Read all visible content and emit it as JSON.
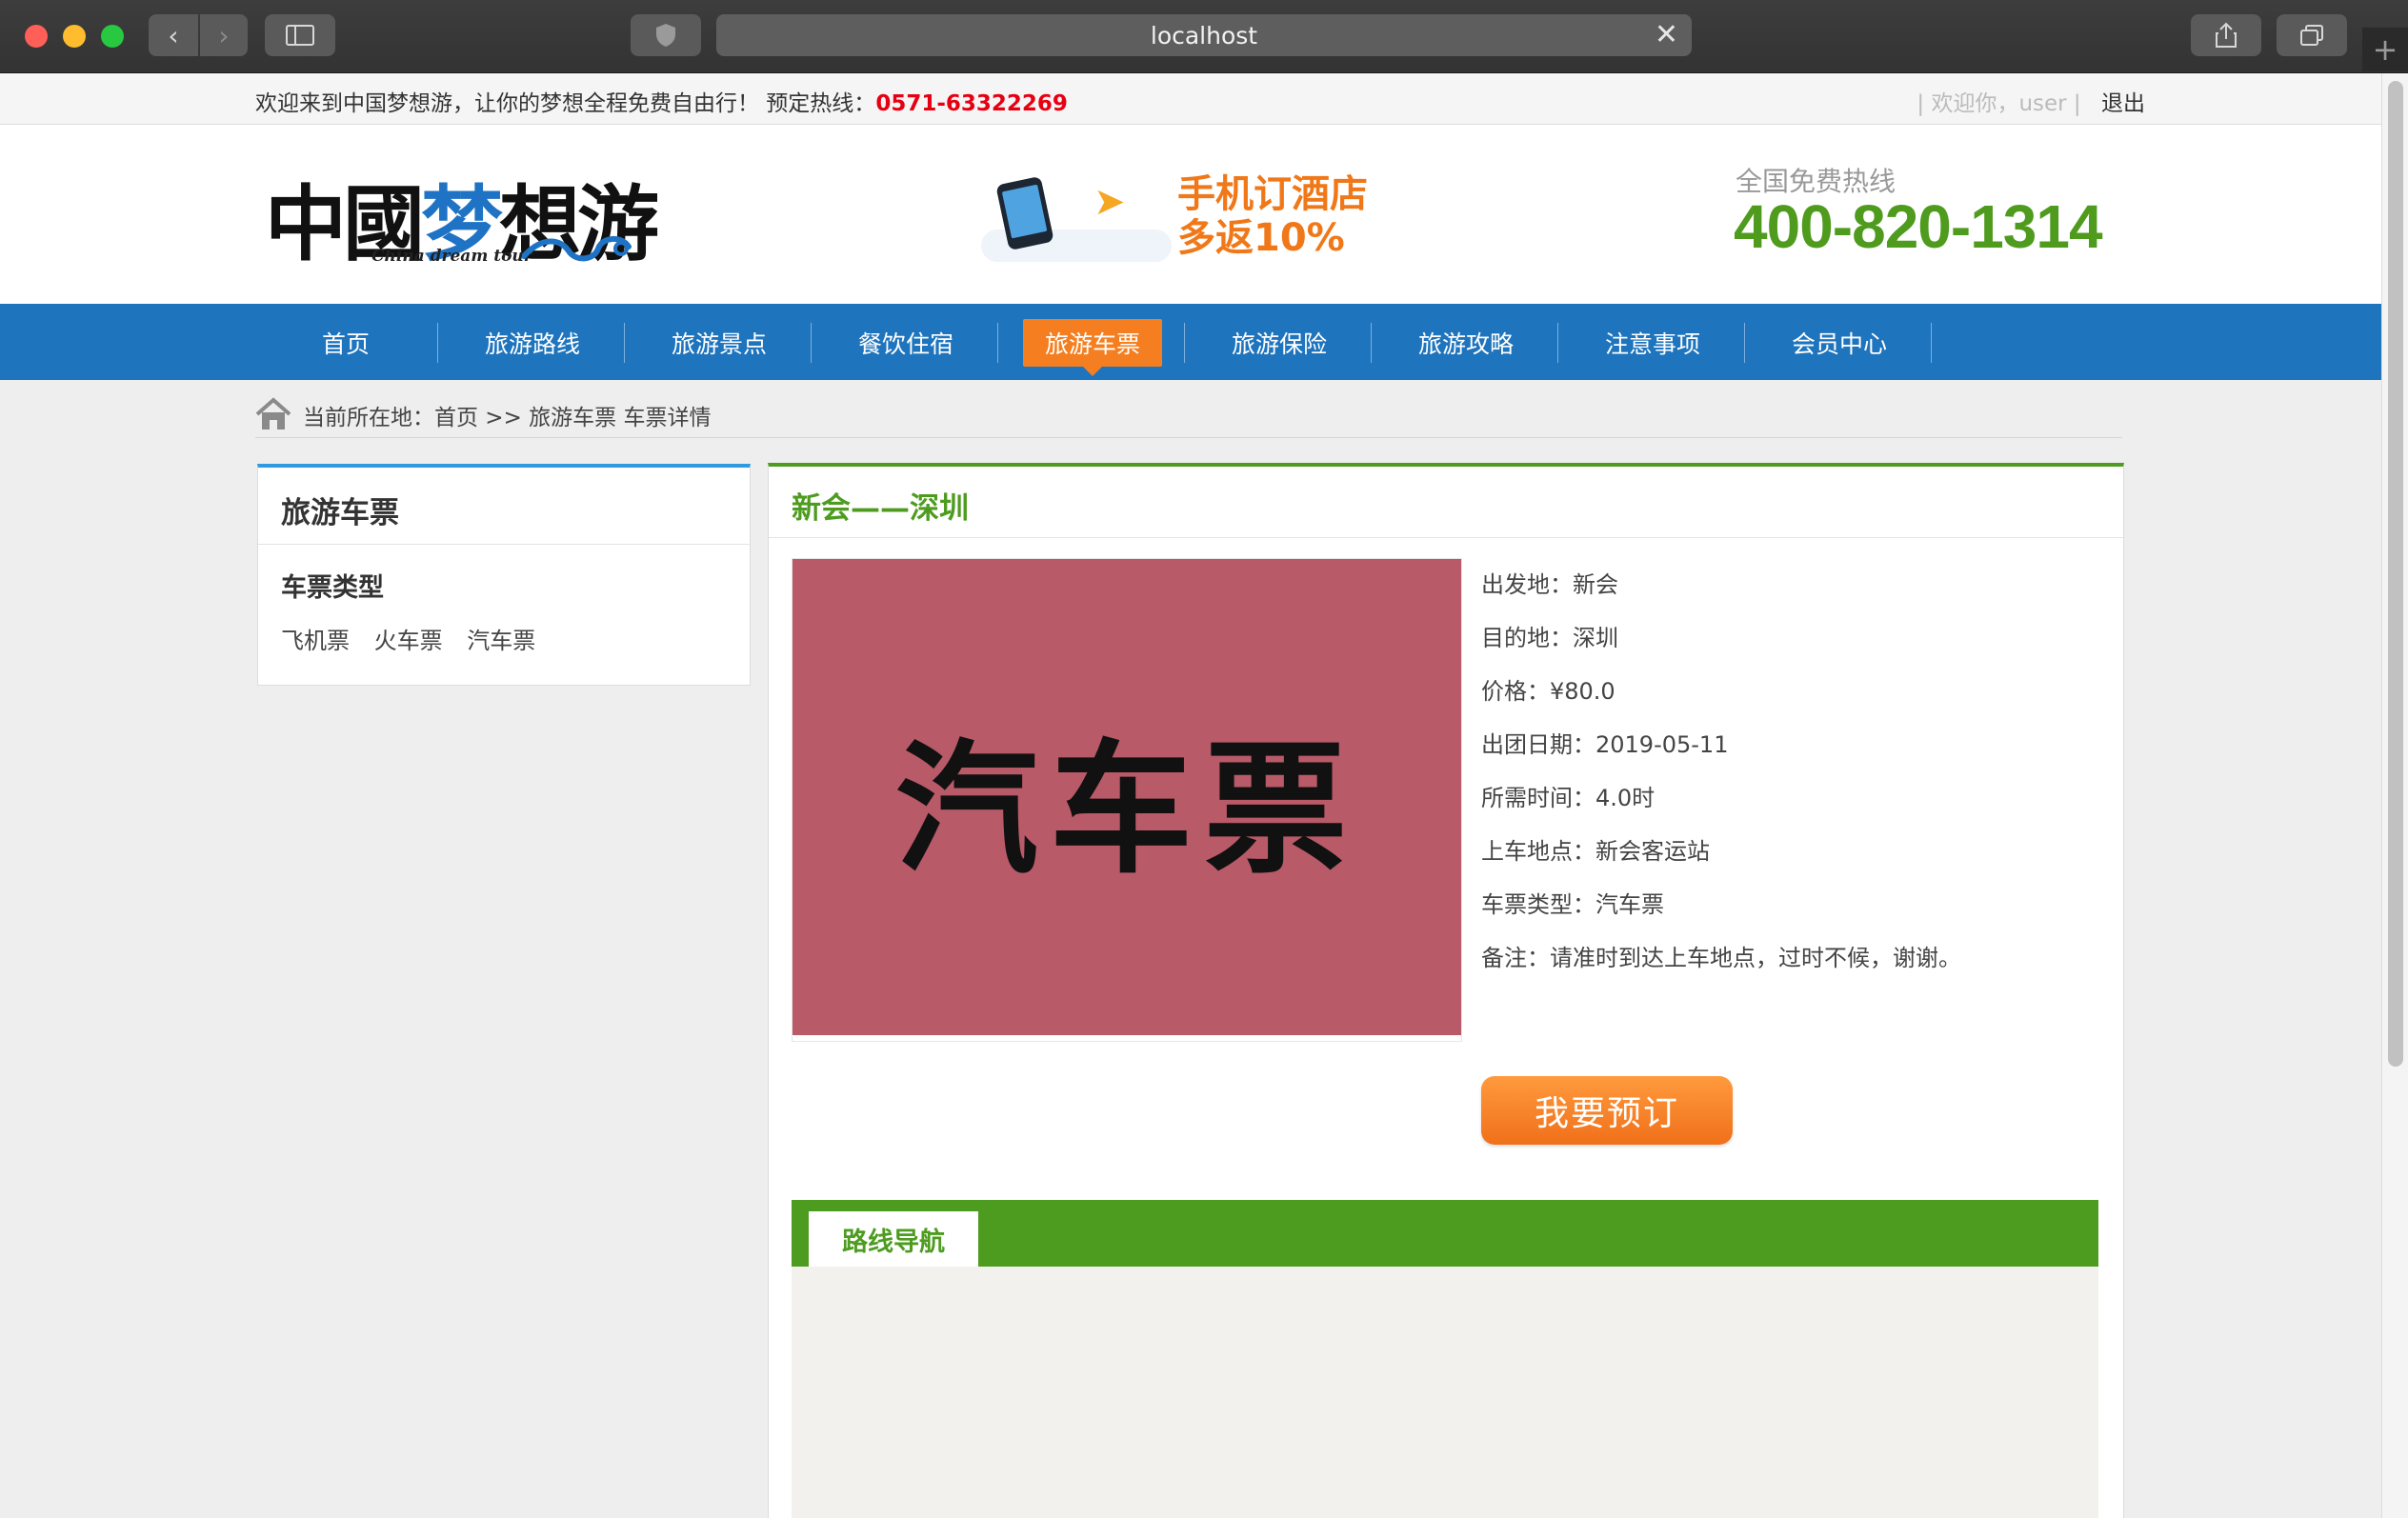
{
  "browser": {
    "url": "localhost"
  },
  "topbar": {
    "welcome": "欢迎来到中国梦想游，让你的梦想全程免费自由行！ 预定热线：",
    "hotline": "0571-63322269",
    "greeting": "| 欢迎你，user |",
    "logout": "退出"
  },
  "header": {
    "logo_text_a": "中國",
    "logo_text_b": "梦",
    "logo_text_c": "想游",
    "logo_sub": "China dream tour",
    "promo_line1": "手机订酒店",
    "promo_line2": "多返10%",
    "hotline_label": "全国免费热线",
    "hotline_number": "400-820-1314"
  },
  "nav": {
    "items": [
      {
        "label": "首页"
      },
      {
        "label": "旅游路线"
      },
      {
        "label": "旅游景点"
      },
      {
        "label": "餐饮住宿"
      },
      {
        "label": "旅游车票"
      },
      {
        "label": "旅游保险"
      },
      {
        "label": "旅游攻略"
      },
      {
        "label": "注意事项"
      },
      {
        "label": "会员中心"
      }
    ],
    "active_index": 4
  },
  "breadcrumb": {
    "text": "当前所在地：首页 >> 旅游车票 车票详情"
  },
  "sidebar": {
    "title": "旅游车票",
    "subtitle": "车票类型",
    "links": [
      "飞机票",
      "火车票",
      "汽车票"
    ]
  },
  "detail": {
    "title": "新会——深圳",
    "image_text": "汽车票",
    "image_color": "#b95a68",
    "info": [
      "出发地：新会",
      "目的地：深圳",
      "价格：¥80.0",
      "出团日期：2019-05-11",
      "所需时间：4.0时",
      "上车地点：新会客运站",
      "车票类型：汽车票",
      "备注：请准时到达上车地点，过时不候，谢谢。"
    ],
    "book_button": "我要预订",
    "route_tab": "路线导航"
  },
  "colors": {
    "nav_blue": "#1e74bd",
    "accent_orange": "#f57f20",
    "accent_green": "#4e9c1f",
    "hotline_red": "#e60012"
  }
}
